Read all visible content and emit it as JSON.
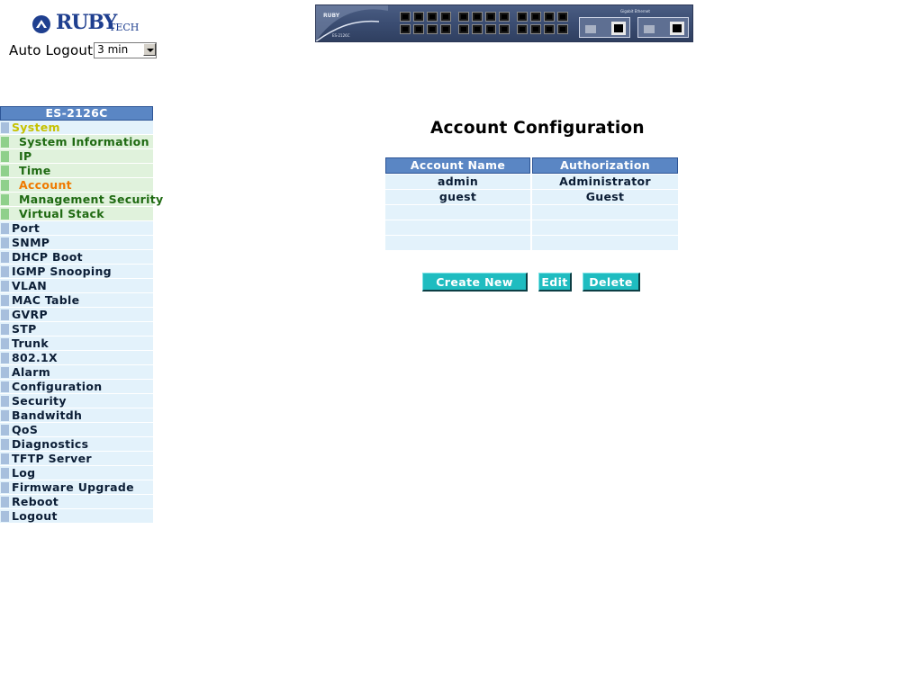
{
  "header": {
    "brand": "RUBY",
    "brand_sub": "TECH",
    "auto_logout_label": "Auto Logout",
    "auto_logout_value": "3 min"
  },
  "device": {
    "model": "ES-2126C",
    "brand": "RUBY",
    "gigabit_label": "Gigabit Ethernet"
  },
  "sidebar": {
    "title": "ES-2126C",
    "items": [
      {
        "label": "System",
        "level": "sys"
      },
      {
        "label": "System Information",
        "level": "sub"
      },
      {
        "label": "IP",
        "level": "sub"
      },
      {
        "label": "Time",
        "level": "sub"
      },
      {
        "label": "Account",
        "level": "sub",
        "active": true
      },
      {
        "label": "Management Security",
        "level": "sub"
      },
      {
        "label": "Virtual Stack",
        "level": "sub"
      },
      {
        "label": "Port",
        "level": "top"
      },
      {
        "label": "SNMP",
        "level": "top"
      },
      {
        "label": "DHCP Boot",
        "level": "top"
      },
      {
        "label": "IGMP Snooping",
        "level": "top"
      },
      {
        "label": "VLAN",
        "level": "top"
      },
      {
        "label": "MAC Table",
        "level": "top"
      },
      {
        "label": "GVRP",
        "level": "top"
      },
      {
        "label": "STP",
        "level": "top"
      },
      {
        "label": "Trunk",
        "level": "top"
      },
      {
        "label": "802.1X",
        "level": "top"
      },
      {
        "label": "Alarm",
        "level": "top"
      },
      {
        "label": "Configuration",
        "level": "top"
      },
      {
        "label": "Security",
        "level": "top"
      },
      {
        "label": "Bandwitdh",
        "level": "top"
      },
      {
        "label": "QoS",
        "level": "top"
      },
      {
        "label": "Diagnostics",
        "level": "top"
      },
      {
        "label": "TFTP Server",
        "level": "top"
      },
      {
        "label": "Log",
        "level": "top"
      },
      {
        "label": "Firmware Upgrade",
        "level": "top"
      },
      {
        "label": "Reboot",
        "level": "top"
      },
      {
        "label": "Logout",
        "level": "top"
      }
    ]
  },
  "main": {
    "title": "Account Configuration",
    "table": {
      "headers": [
        "Account Name",
        "Authorization"
      ],
      "rows": [
        [
          "admin",
          "Administrator"
        ],
        [
          "guest",
          "Guest"
        ],
        [
          "",
          ""
        ],
        [
          "",
          ""
        ],
        [
          "",
          ""
        ]
      ]
    },
    "buttons": {
      "create_new": "Create New",
      "edit": "Edit",
      "delete": "Delete"
    }
  }
}
